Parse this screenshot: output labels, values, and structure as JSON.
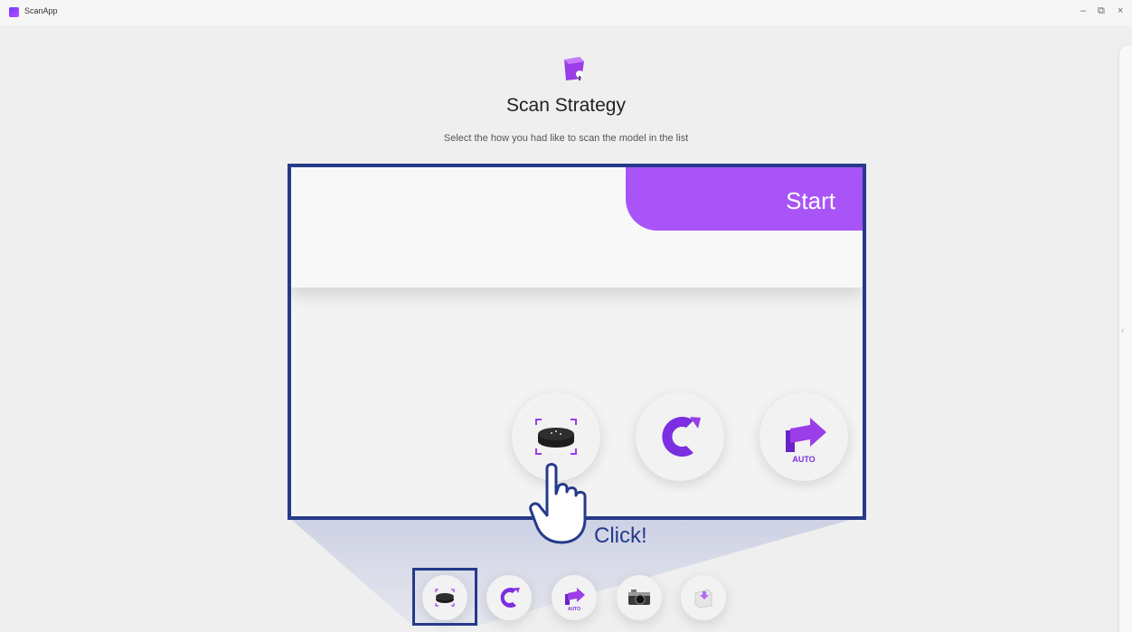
{
  "window": {
    "title": "ScanApp",
    "minimize": "–",
    "restore": "⧉",
    "close": "×"
  },
  "header": {
    "icon": "purple-box-icon",
    "title": "Scan Strategy",
    "subtitle": "Select the how you had like to scan the model in the list"
  },
  "zoom": {
    "start_label": "Start",
    "options": [
      {
        "name": "turntable-option",
        "icon": "turntable-icon"
      },
      {
        "name": "rotate-option",
        "icon": "rotate-c-icon"
      },
      {
        "name": "auto-option",
        "icon": "auto-arrow-icon",
        "label": "AUTO"
      }
    ]
  },
  "annotation": {
    "click_label": "Click!",
    "hand_icon": "pointing-hand-icon"
  },
  "strategies": [
    {
      "name": "turntable",
      "icon": "turntable-icon",
      "selected": true
    },
    {
      "name": "rotate",
      "icon": "rotate-c-icon"
    },
    {
      "name": "auto",
      "icon": "auto-arrow-icon",
      "label": "AUTO"
    },
    {
      "name": "camera",
      "icon": "camera-icon"
    },
    {
      "name": "import",
      "icon": "import-box-icon"
    }
  ],
  "right_panel": {
    "toggle": "‹"
  },
  "colors": {
    "accent": "#a854f7",
    "highlight": "#253a8a",
    "brand_purple": "#7b2fe0"
  }
}
